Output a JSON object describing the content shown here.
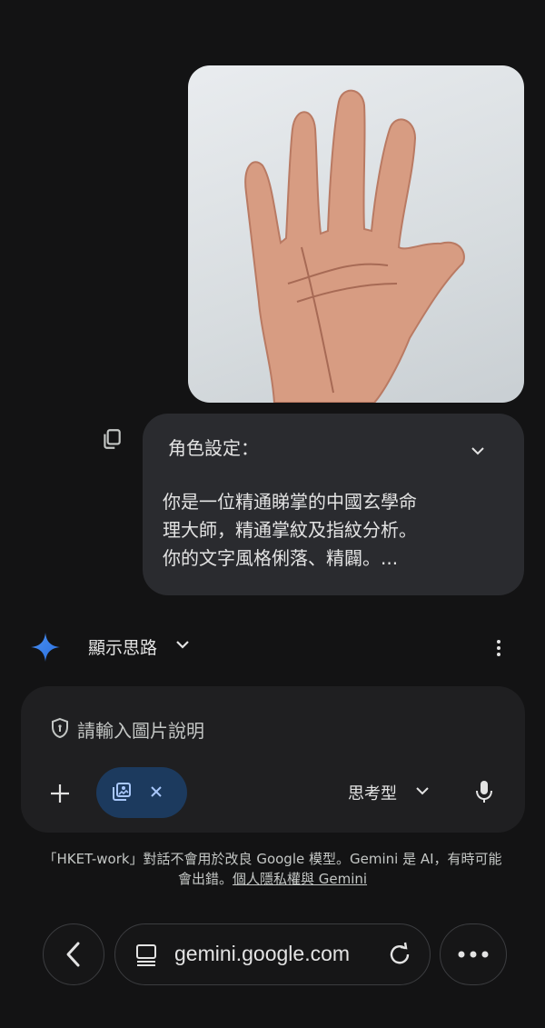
{
  "message": {
    "heading": "角色設定：",
    "body_lines": [
      "你是一位精通睇掌的中國玄學命",
      "理大師，精通掌紋及指紋分析。",
      "你的文字風格俐落、精闢。..."
    ]
  },
  "response": {
    "thinking_label": "顯示思路"
  },
  "composer": {
    "placeholder": "請輸入圖片說明",
    "model_label": "思考型"
  },
  "disclaimer": {
    "line1": "「HKET-work」對話不會用於改良 Google 模型。Gemini 是 AI，有時可能",
    "line2_prefix": "會出錯。",
    "link": "個人隱私權與 Gemini"
  },
  "browser": {
    "url": "gemini.google.com"
  },
  "icons": {
    "copy": "copy-icon",
    "spark": "gemini-spark-icon",
    "more": "more-vert-icon",
    "shield": "shield-icon",
    "plus": "plus-icon",
    "image": "image-stack-icon",
    "close": "close-icon",
    "mic": "mic-icon",
    "back": "back-icon",
    "tab": "tab-icon",
    "reload": "reload-icon",
    "menu": "more-horiz-icon"
  },
  "colors": {
    "background": "#131314",
    "bubble": "#2a2b2f",
    "chip": "#1c3a5e",
    "accent": "#4a90f0"
  }
}
